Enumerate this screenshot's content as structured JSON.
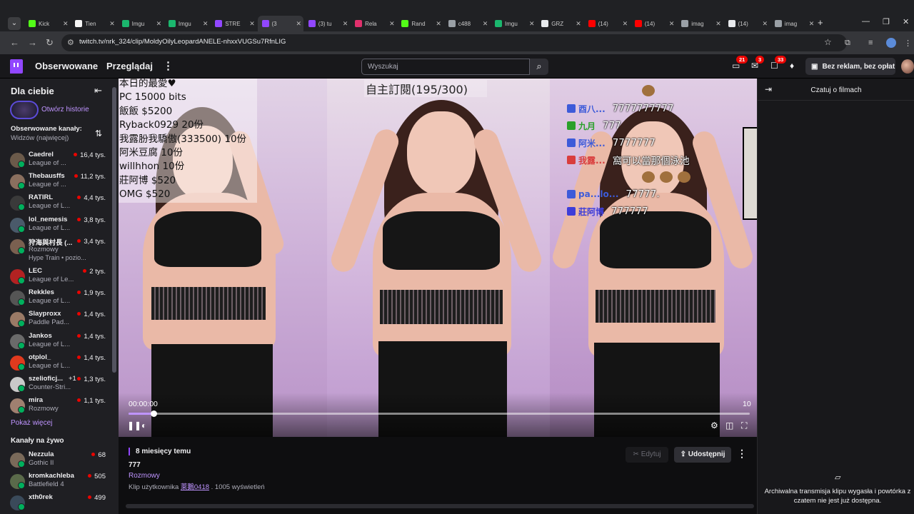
{
  "browser": {
    "tabs": [
      {
        "label": "Kick",
        "color": "#53fc18"
      },
      {
        "label": "Tien",
        "color": "#f5f5f5"
      },
      {
        "label": "Imgu",
        "color": "#1bb76e"
      },
      {
        "label": "Imgu",
        "color": "#1bb76e"
      },
      {
        "label": "STRE",
        "color": "#9147ff"
      },
      {
        "label": "(3",
        "color": "#9147ff",
        "active": true
      },
      {
        "label": "(3) tu",
        "color": "#9147ff"
      },
      {
        "label": "Rela",
        "color": "#e1306c"
      },
      {
        "label": "Rand",
        "color": "#53fc18"
      },
      {
        "label": "c488",
        "color": "#9aa0a6"
      },
      {
        "label": "Imgu",
        "color": "#1bb76e"
      },
      {
        "label": "GRZ",
        "color": "#e8eaed"
      },
      {
        "label": "(14)",
        "color": "#ff0000"
      },
      {
        "label": "(14)",
        "color": "#ff0000"
      },
      {
        "label": "imag",
        "color": "#9aa0a6"
      },
      {
        "label": "(14)",
        "color": "#e8eaed"
      },
      {
        "label": "imag",
        "color": "#9aa0a6"
      }
    ],
    "url": "twitch.tv/nrk_324/clip/MoldyOilyLeopardANELE-nhxxVUGSu7RfnLIG"
  },
  "twitch": {
    "nav_following": "Obserwowane",
    "nav_browse": "Przeglądaj",
    "search_placeholder": "Wyszukaj",
    "badge_inbox": "21",
    "badge_whispers": "3",
    "badge_notifications": "33",
    "adfree_label": "Bez reklam, bez opłat"
  },
  "sidebar": {
    "for_you": "Dla ciebie",
    "open_history": "Otwórz historie",
    "followed_title": "Obserwowane kanały:",
    "followed_sort": "Widzów (najwięcej)",
    "channels": [
      {
        "name": "Caedrel",
        "game": "League of ...",
        "viewers": "16,4 tys.",
        "color": "#6b5a4a"
      },
      {
        "name": "Thebausffs",
        "game": "League of ...",
        "viewers": "11,2 tys.",
        "color": "#8a6f5e"
      },
      {
        "name": "RATIRL",
        "game": "League of L...",
        "viewers": "4,4 tys.",
        "color": "#3a3a3a"
      },
      {
        "name": "lol_nemesis",
        "game": "League of L...",
        "viewers": "3,8 tys.",
        "color": "#4a5a6a"
      },
      {
        "name": "狩海與村長 (...",
        "game": "Rozmowy",
        "viewers": "3,4 tys.",
        "color": "#7a6050",
        "extra": "Hype Train • pozio..."
      },
      {
        "name": "LEC",
        "game": "League of Le...",
        "viewers": "2 tys.",
        "color": "#b22222"
      },
      {
        "name": "Rekkles",
        "game": "League of L...",
        "viewers": "1,9 tys.",
        "color": "#555"
      },
      {
        "name": "Slayproxx",
        "game": "Paddle Pad...",
        "viewers": "1,4 tys.",
        "color": "#9a7a66"
      },
      {
        "name": "Jankos",
        "game": "League of L...",
        "viewers": "1,4 tys.",
        "color": "#6a6a6a"
      },
      {
        "name": "otplol_",
        "game": "League of L...",
        "viewers": "1,4 tys.",
        "color": "#e03a1e"
      },
      {
        "name": "szelioficj...",
        "game": "Counter-Stri...",
        "viewers": "1,3 tys.",
        "color": "#c9c9c9",
        "extra_right": "+1"
      },
      {
        "name": "mira",
        "game": "Rozmowy",
        "viewers": "1,1 tys.",
        "color": "#a08070"
      }
    ],
    "show_more": "Pokaż więcej",
    "live_title": "Kanały na żywo",
    "live_channels": [
      {
        "name": "Nezzula",
        "game": "Gothic II",
        "viewers": "68",
        "color": "#7a6a5a"
      },
      {
        "name": "kromkachleba",
        "game": "Battlefield 4",
        "viewers": "505",
        "color": "#5a6a4a"
      },
      {
        "name": "xth0rek",
        "game": "",
        "viewers": "499",
        "color": "#3a4a5a"
      }
    ]
  },
  "video": {
    "donor_lines": [
      "本日的最愛♥",
      "PC  15000 bits",
      "飯飯 $5200",
      "Ryback0929 20份",
      "我露朌我驕傲(333500)  10份",
      "阿米豆腐 10份",
      "willhhon 10份",
      "莊阿博 $520",
      "OMG $520"
    ],
    "subs_counter": "自主訂閱(195/300)",
    "chat": [
      {
        "user": "",
        "msg": "",
        "color": "#a0703d",
        "emote": true
      },
      {
        "user": "酉八...",
        "msg": "7777777777",
        "color": "#3d5bd9"
      },
      {
        "user": "九月",
        "msg": "777",
        "color": "#2aa02a"
      },
      {
        "user": "阿米...",
        "msg": "7777777",
        "color": "#3d5bd9"
      },
      {
        "user": "我露...",
        "msg": "窩可以當那個泳池",
        "color": "#d93d3d"
      },
      {
        "user": "",
        "msg": "",
        "color": "#a0703d",
        "emote": true
      },
      {
        "user": "pa...lo...",
        "msg": "77777.",
        "color": "#3d5bd9"
      },
      {
        "user": "莊阿博",
        "msg": "777777",
        "color": "#3d3dd9"
      }
    ],
    "time_current": "00:00:00",
    "time_end": "10",
    "progress": 0.04
  },
  "clip": {
    "age": "8 miesięcy temu",
    "title": "777",
    "category": "Rozmowy",
    "by_prefix": "Klip użytkownika",
    "by_user": "萊鵝0418",
    "by_suffix": ". 1005 wyświetleń",
    "edit_label": "Edytuj",
    "share_label": "Udostępnij"
  },
  "chat_panel": {
    "title": "Czatuj o filmach",
    "note_line1": "Archiwalna transmisja klipu wygasła i powtórka z",
    "note_line2": "czatem nie jest już dostępna."
  }
}
